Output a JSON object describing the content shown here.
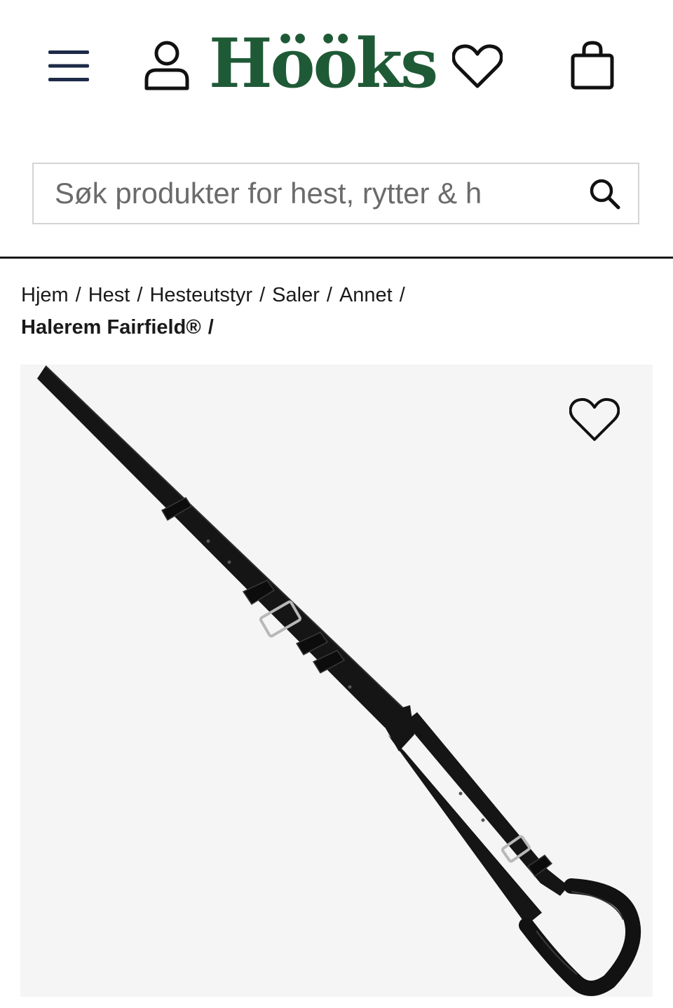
{
  "header": {
    "logo_text": "Hööks",
    "icons": {
      "menu": "hamburger-menu-icon",
      "account": "user-icon",
      "wishlist": "heart-icon",
      "cart": "shopping-bag-icon"
    }
  },
  "search": {
    "placeholder": "Søk produkter for hest, rytter & h",
    "value": "",
    "icon": "search-icon"
  },
  "breadcrumb": {
    "items": [
      "Hjem",
      "Hest",
      "Hesteutstyr",
      "Saler",
      "Annet"
    ],
    "current": "Halerem Fairfield®",
    "separator": "/"
  },
  "product": {
    "image_icon": "crupper-strap-image",
    "favorite_icon": "heart-icon"
  },
  "colors": {
    "brand_green": "#1f5a36",
    "nav_blue": "#1d2a48",
    "image_background": "#f5f5f5"
  }
}
